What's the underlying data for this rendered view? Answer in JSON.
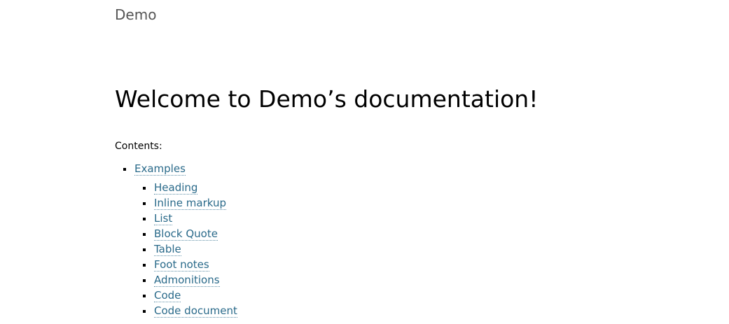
{
  "header": {
    "site_title": "Demo"
  },
  "main": {
    "title": "Welcome to Demo’s documentation!",
    "caption": "Contents:",
    "toc": {
      "top_item": "Examples",
      "sub_items": [
        "Heading",
        "Inline markup",
        "List",
        "Block Quote",
        "Table",
        "Foot notes",
        "Admonitions",
        "Code",
        "Code document"
      ]
    }
  },
  "colors": {
    "link": "#2a6a8a",
    "site_title": "#555555",
    "text": "#000000"
  }
}
